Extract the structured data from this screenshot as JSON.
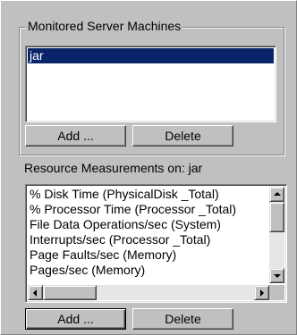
{
  "monitored_servers": {
    "group_label": "Monitored Server Machines",
    "items": [
      "jar"
    ],
    "selected_index": 0,
    "add_label": "Add ...",
    "delete_label": "Delete"
  },
  "resource_measurements": {
    "label": "Resource Measurements on: jar",
    "items": [
      "% Disk Time (PhysicalDisk _Total)",
      "% Processor Time (Processor _Total)",
      "File Data Operations/sec (System)",
      "Interrupts/sec (Processor _Total)",
      "Page Faults/sec (Memory)",
      "Pages/sec (Memory)"
    ],
    "add_label": "Add ...",
    "delete_label": "Delete"
  },
  "icons": {
    "scroll_up": "arrow-up-icon",
    "scroll_down": "arrow-down-icon",
    "scroll_left": "arrow-left-icon",
    "scroll_right": "arrow-right-icon"
  },
  "colors": {
    "face": "#c0c0c0",
    "selection": "#0a246a",
    "list_bg": "#ffffff"
  }
}
